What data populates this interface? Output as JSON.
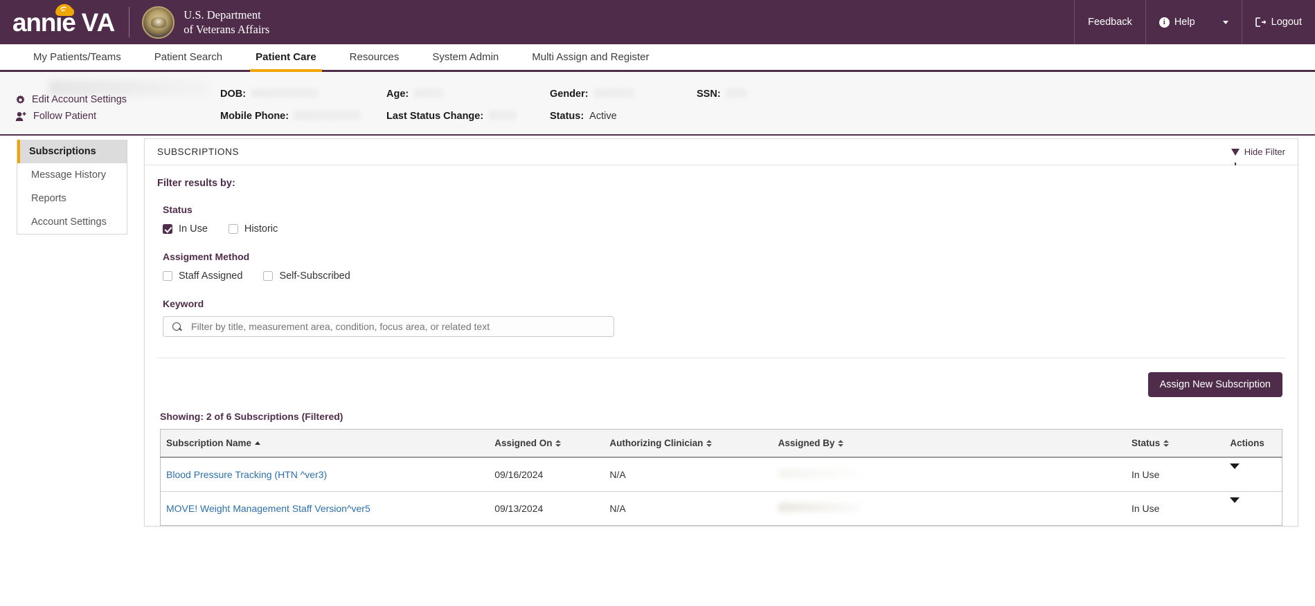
{
  "header": {
    "brand_name": "annie",
    "brand_suffix": "VA",
    "agency_line1": "U.S. Department",
    "agency_line2": "of Veterans Affairs",
    "actions": {
      "feedback": "Feedback",
      "help": "Help",
      "logout": "Logout"
    },
    "accent_purple": "#4f2d4a",
    "accent_gold": "#f0a500"
  },
  "nav": {
    "items": [
      {
        "label": "My Patients/Teams",
        "active": false
      },
      {
        "label": "Patient Search",
        "active": false
      },
      {
        "label": "Patient Care",
        "active": true
      },
      {
        "label": "Resources",
        "active": false
      },
      {
        "label": "System Admin",
        "active": false
      },
      {
        "label": "Multi Assign and Register",
        "active": false
      }
    ]
  },
  "patient_bar": {
    "links": [
      {
        "label": "Edit Account Settings",
        "icon": "gear-icon"
      },
      {
        "label": "Follow Patient",
        "icon": "person-plus-icon"
      }
    ],
    "fields": [
      {
        "label": "DOB:",
        "value": ""
      },
      {
        "label": "Age:",
        "value": ""
      },
      {
        "label": "Gender:",
        "value": ""
      },
      {
        "label": "SSN:",
        "value": ""
      },
      {
        "label": "Mobile Phone:",
        "value": ""
      },
      {
        "label": "Last Status Change:",
        "value": ""
      },
      {
        "label": "Status:",
        "value": "Active"
      }
    ]
  },
  "sidenav": {
    "items": [
      {
        "label": "Subscriptions",
        "active": true
      },
      {
        "label": "Message History",
        "active": false
      },
      {
        "label": "Reports",
        "active": false
      },
      {
        "label": "Account Settings",
        "active": false
      }
    ]
  },
  "panel": {
    "title": "SUBSCRIPTIONS",
    "hide_filter_label": "Hide Filter",
    "filter": {
      "heading": "Filter results by:",
      "status_group_label": "Status",
      "status_options": [
        {
          "label": "In Use",
          "checked": true
        },
        {
          "label": "Historic",
          "checked": false
        }
      ],
      "assignment_group_label": "Assigment Method",
      "assignment_options": [
        {
          "label": "Staff Assigned",
          "checked": false
        },
        {
          "label": "Self-Subscribed",
          "checked": false
        }
      ],
      "keyword_label": "Keyword",
      "keyword_value": "",
      "keyword_placeholder": "Filter by title, measurement area, condition, focus area, or related text"
    },
    "assign_button_label": "Assign New Subscription",
    "showing_text": "Showing: 2 of 6 Subscriptions (Filtered)",
    "table": {
      "columns": [
        {
          "label": "Subscription Name",
          "sort": "asc"
        },
        {
          "label": "Assigned On",
          "sort": "both"
        },
        {
          "label": "Authorizing Clinician",
          "sort": "both"
        },
        {
          "label": "Assigned By",
          "sort": "both"
        },
        {
          "label": "Status",
          "sort": "both"
        },
        {
          "label": "Actions",
          "sort": "none"
        }
      ],
      "rows": [
        {
          "name": "Blood Pressure Tracking (HTN ^ver3)",
          "assigned_on": "09/16/2024",
          "authorizing_clinician": "N/A",
          "assigned_by": "",
          "status": "In Use"
        },
        {
          "name": "MOVE! Weight Management Staff Version^ver5",
          "assigned_on": "09/13/2024",
          "authorizing_clinician": "N/A",
          "assigned_by": "",
          "status": "In Use"
        }
      ]
    }
  }
}
